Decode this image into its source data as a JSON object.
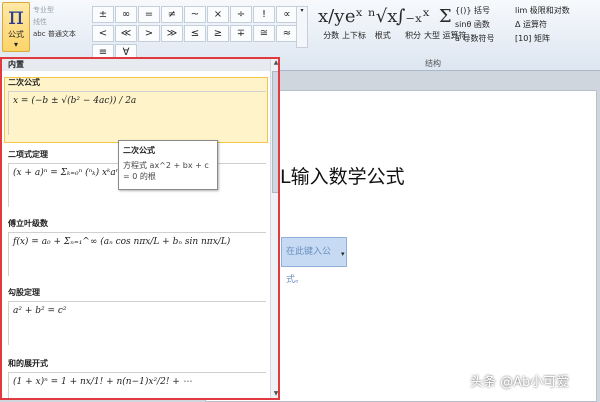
{
  "ribbon": {
    "equation_btn": {
      "glyph": "π",
      "label": "公式",
      "arrow": "▾"
    },
    "tools": [
      "专业型",
      "线性",
      "普通文本"
    ],
    "tool_prefix_glyph": "abc",
    "symbols": [
      "±",
      "∞",
      "=",
      "≠",
      "~",
      "×",
      "÷",
      "!",
      "∝",
      "<",
      "≪",
      ">",
      "≫",
      "≤",
      "≥",
      "∓",
      "≅",
      "≈",
      "≡",
      "∀"
    ],
    "scroll_glyph": "▾",
    "structures": [
      {
        "glyph": "x/y",
        "label": "分数"
      },
      {
        "glyph": "eˣ",
        "label": "上下标"
      },
      {
        "glyph": "ⁿ√x",
        "label": "根式"
      },
      {
        "glyph": "∫₋ₓˣ",
        "label": "积分"
      },
      {
        "glyph": "Σ",
        "label": "大型\n运算符"
      }
    ],
    "structure_list": [
      {
        "glyph": "{()}",
        "label": "括号"
      },
      {
        "glyph": "sinθ",
        "label": "函数"
      },
      {
        "glyph": "ä",
        "label": "导数符号"
      },
      {
        "glyph": "lim",
        "label": "极限和对数"
      },
      {
        "glyph": "Δ",
        "label": "运算符"
      },
      {
        "glyph": "[10]",
        "label": "矩阵"
      }
    ],
    "group_label": "结构"
  },
  "gallery": {
    "header": "内置",
    "items": [
      {
        "category": "二次公式",
        "title": "二次公式",
        "formula": "x = (−b ± √(b² − 4ac)) / 2a"
      },
      {
        "category": "二项式定理",
        "title": "二项式定理",
        "formula": "(x + a)ⁿ = Σₖ₌₀ⁿ (ⁿₖ) xᵏaⁿ⁻ᵏ"
      },
      {
        "category": "傅立叶级数",
        "title": "傅立叶级数",
        "formula": "f(x) = a₀ + Σₙ₌₁^∞ (aₙ cos nπx/L + bₙ sin nπx/L)"
      },
      {
        "category": "勾股定理",
        "title": "勾股定理",
        "formula": "a² + b² = c²"
      },
      {
        "category": "和的展开式",
        "title": "和的展开式",
        "formula": "(1 + x)ⁿ = 1 + nx/1! + n(n−1)x²/2! + ⋯"
      }
    ]
  },
  "tooltip": {
    "title": "二次公式",
    "body": "方程式 ax^2 + bx + c = 0 的根"
  },
  "document": {
    "title": "L输入数学公式",
    "placeholder": "在此键入公式。",
    "dropdown_glyph": "▾",
    "return_mark": "↵"
  },
  "watermark": "头条 @Ab小可爱"
}
